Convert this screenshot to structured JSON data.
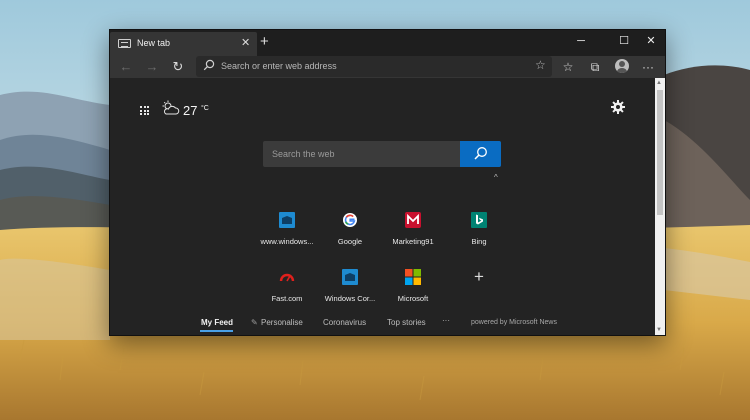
{
  "window": {
    "tab_title": "New tab",
    "tab_close": "✕",
    "new_tab": "+",
    "controls": {
      "minimize": "─",
      "maximize": "☐",
      "close": "✕"
    }
  },
  "toolbar": {
    "back": "←",
    "forward": "→",
    "refresh": "↻",
    "address_placeholder": "Search or enter web address",
    "favorite": "☆",
    "favorites_bar": "☆",
    "collections": "⧉",
    "more": "···"
  },
  "ntp": {
    "temperature": "27",
    "temp_unit": "°C",
    "search_placeholder": "Search the web",
    "collapse": "^",
    "tiles": [
      {
        "label": "www.windows...",
        "icon": "windows-store-icon"
      },
      {
        "label": "Google",
        "icon": "google-icon"
      },
      {
        "label": "Marketing91",
        "icon": "marketing91-icon"
      },
      {
        "label": "Bing",
        "icon": "bing-icon"
      },
      {
        "label": "Fast.com",
        "icon": "fast-icon"
      },
      {
        "label": "Windows Cor...",
        "icon": "windows-store-icon"
      },
      {
        "label": "Microsoft",
        "icon": "microsoft-icon"
      },
      {
        "label": "",
        "icon": "add-tile-icon"
      }
    ],
    "add_symbol": "+",
    "feed": {
      "my_feed": "My Feed",
      "personalise": "Personalise",
      "coronavirus": "Coronavirus",
      "top_stories": "Top stories",
      "more": "···",
      "powered_by": "powered by Microsoft News"
    }
  },
  "colors": {
    "accent": "#0a6cc2",
    "window_bg": "#232323",
    "titlebar": "#1e1e1e",
    "toolbar": "#353535",
    "feed_underline": "#4aa0e6"
  }
}
